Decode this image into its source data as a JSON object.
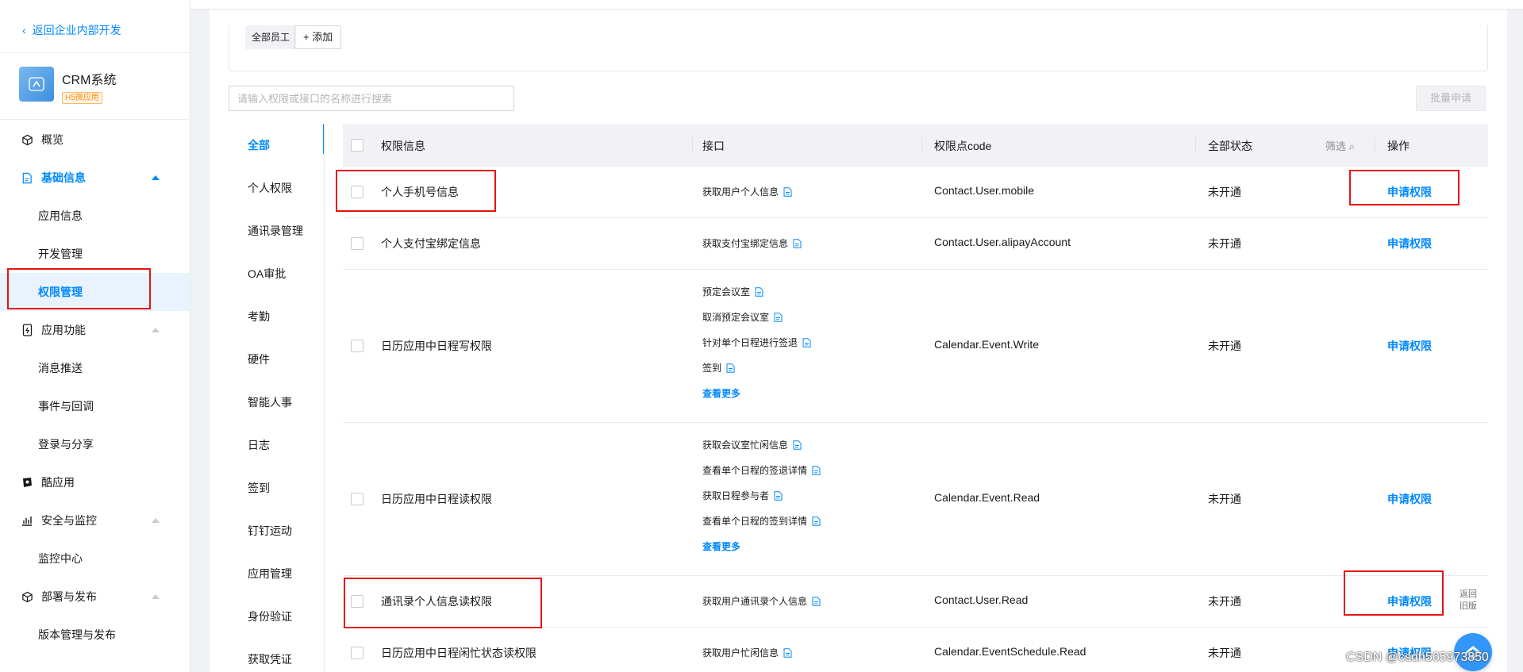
{
  "sidebar": {
    "back_label": "返回企业内部开发",
    "app": {
      "name": "CRM系统",
      "tag": "H5微应用"
    },
    "nav": [
      {
        "label": "概览",
        "type": "top",
        "icon": "cube-icon"
      },
      {
        "label": "基础信息",
        "type": "top",
        "icon": "doc-icon",
        "active": true,
        "caret": true
      },
      {
        "label": "应用信息",
        "type": "sub"
      },
      {
        "label": "开发管理",
        "type": "sub"
      },
      {
        "label": "权限管理",
        "type": "sub",
        "selected": true
      },
      {
        "label": "应用功能",
        "type": "top",
        "icon": "phone-icon",
        "caret": true
      },
      {
        "label": "消息推送",
        "type": "sub"
      },
      {
        "label": "事件与回调",
        "type": "sub"
      },
      {
        "label": "登录与分享",
        "type": "sub"
      },
      {
        "label": "酷应用",
        "type": "top",
        "icon": "cool-app-icon"
      },
      {
        "label": "安全与监控",
        "type": "top",
        "icon": "bar-chart-icon",
        "caret": true
      },
      {
        "label": "监控中心",
        "type": "sub"
      },
      {
        "label": "部署与发布",
        "type": "top",
        "icon": "cube-icon",
        "caret": true
      },
      {
        "label": "版本管理与发布",
        "type": "sub"
      }
    ]
  },
  "group": {
    "all_label": "全部员工",
    "add_label": "+ 添加"
  },
  "search": {
    "placeholder": "请输入权限或接口的名称进行搜索"
  },
  "batch_label": "批量申请",
  "categories": [
    "全部",
    "个人权限",
    "通讯录管理",
    "OA审批",
    "考勤",
    "硬件",
    "智能人事",
    "日志",
    "签到",
    "钉钉运动",
    "应用管理",
    "身份验证",
    "获取凭证"
  ],
  "table": {
    "headers": {
      "name": "权限信息",
      "api": "接口",
      "code": "权限点code",
      "status": "全部状态",
      "filter": "筛选",
      "op": "操作"
    },
    "rows": [
      {
        "name": "个人手机号信息",
        "apis": [
          "获取用户个人信息"
        ],
        "code": "Contact.User.mobile",
        "status": "未开通",
        "op": "申请权限"
      },
      {
        "name": "个人支付宝绑定信息",
        "apis": [
          "获取支付宝绑定信息"
        ],
        "code": "Contact.User.alipayAccount",
        "status": "未开通",
        "op": "申请权限"
      },
      {
        "name": "日历应用中日程写权限",
        "apis": [
          "预定会议室",
          "取消预定会议室",
          "针对单个日程进行签退",
          "签到"
        ],
        "more": "查看更多",
        "code": "Calendar.Event.Write",
        "status": "未开通",
        "op": "申请权限"
      },
      {
        "name": "日历应用中日程读权限",
        "apis": [
          "获取会议室忙闲信息",
          "查看单个日程的签退详情",
          "获取日程参与者",
          "查看单个日程的签到详情"
        ],
        "more": "查看更多",
        "code": "Calendar.Event.Read",
        "status": "未开通",
        "op": "申请权限"
      },
      {
        "name": "通讯录个人信息读权限",
        "apis": [
          "获取用户通讯录个人信息"
        ],
        "code": "Contact.User.Read",
        "status": "未开通",
        "op": "申请权限"
      },
      {
        "name": "日历应用中日程闲忙状态读权限",
        "apis": [
          "获取用户忙闲信息"
        ],
        "code": "Calendar.EventSchedule.Read",
        "status": "未开通",
        "op": "申请权限"
      }
    ]
  },
  "float": {
    "back_line1": "返回",
    "back_line2": "旧版"
  },
  "watermark": "CSDN @csdn565973850",
  "colors": {
    "accent": "#0089ff",
    "highlight": "#e61414"
  }
}
